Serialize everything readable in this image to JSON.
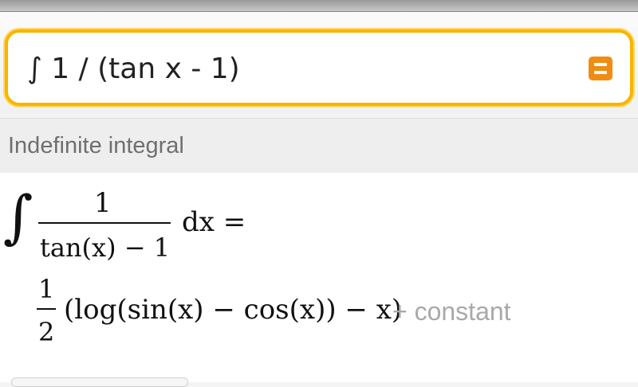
{
  "search": {
    "query": "∫ 1 / (tan x - 1)",
    "button_icon": "equals-icon",
    "accent_color": "#f7b500",
    "button_color": "#f08c14"
  },
  "pod": {
    "title": "Indefinite integral",
    "integral_sign": "∫",
    "integrand_numerator": "1",
    "integrand_denominator": "tan(x) − 1",
    "differential": "dx =",
    "result_coefficient_numerator": "1",
    "result_coefficient_denominator": "2",
    "result_expression": "(log(sin(x) − cos(x)) − x)",
    "constant_text": "+ constant"
  }
}
